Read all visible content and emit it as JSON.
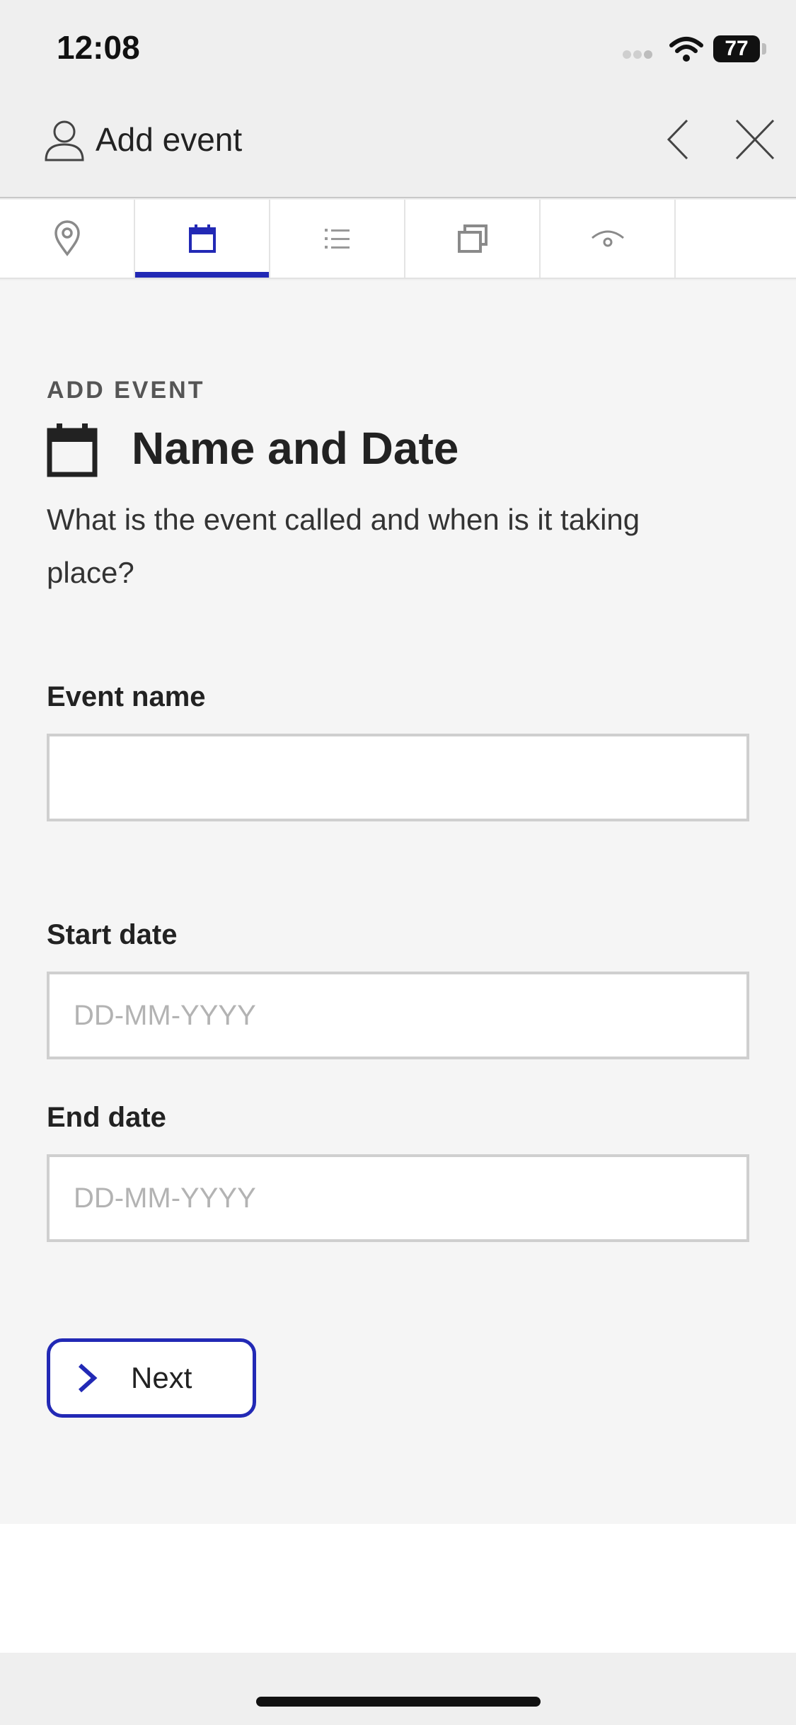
{
  "status_bar": {
    "time": "12:08",
    "battery": "77"
  },
  "header": {
    "title": "Add event",
    "icons": [
      "user-icon",
      "back-chevron-icon",
      "close-icon"
    ]
  },
  "tabs": [
    {
      "icon": "location-pin-icon",
      "active": false
    },
    {
      "icon": "calendar-icon",
      "active": true
    },
    {
      "icon": "list-icon",
      "active": false
    },
    {
      "icon": "copy-icon",
      "active": false
    },
    {
      "icon": "eye-icon",
      "active": false
    }
  ],
  "main": {
    "eyebrow": "ADD EVENT",
    "title": "Name and Date",
    "subtitle": "What is the event called and when is it taking place?",
    "fields": {
      "event_name": {
        "label": "Event name",
        "value": "",
        "placeholder": ""
      },
      "start_date": {
        "label": "Start date",
        "value": "",
        "placeholder": "DD-MM-YYYY"
      },
      "end_date": {
        "label": "End date",
        "value": "",
        "placeholder": "DD-MM-YYYY"
      }
    },
    "next_button": {
      "label": "Next"
    }
  },
  "colors": {
    "accent": "#2229b5",
    "background": "#f5f5f5",
    "header_bg": "#efefef"
  }
}
